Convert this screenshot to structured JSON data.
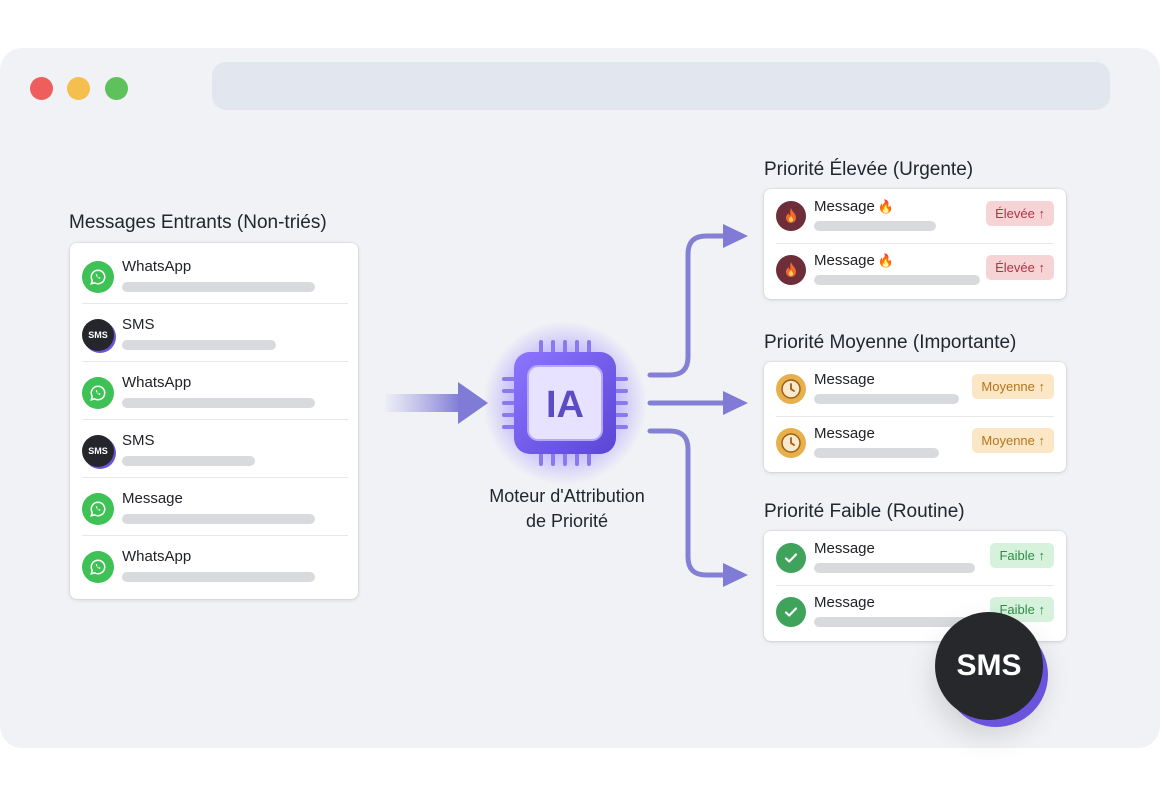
{
  "window": {
    "controls": [
      "close",
      "minimize",
      "maximize"
    ],
    "colors": {
      "close": "#ee5e5d",
      "minimize": "#f4bf4e",
      "maximize": "#5dc25b"
    }
  },
  "inbox": {
    "title": "Messages Entrants (Non-triés)",
    "items": [
      {
        "label": "WhatsApp",
        "icon": "whatsapp-icon"
      },
      {
        "label": "SMS",
        "icon": "sms-icon",
        "icon_text": "SMS"
      },
      {
        "label": "WhatsApp",
        "icon": "whatsapp-icon"
      },
      {
        "label": "SMS",
        "icon": "sms-icon",
        "icon_text": "SMS"
      },
      {
        "label": "Message",
        "icon": "whatsapp-icon"
      },
      {
        "label": "WhatsApp",
        "icon": "whatsapp-icon"
      }
    ]
  },
  "engine": {
    "chip_label": "IA",
    "caption_line1": "Moteur d'Attribution",
    "caption_line2": "de Priorité",
    "accent_color": "#6c5ce7"
  },
  "priorities": {
    "high": {
      "title": "Priorité Élevée (Urgente)",
      "color": "#b03441",
      "items": [
        {
          "label": "Message",
          "badge": "Élevée ↑",
          "icon": "fire-icon"
        },
        {
          "label": "Message",
          "badge": "Élevée ↑",
          "icon": "fire-icon"
        }
      ]
    },
    "medium": {
      "title": "Priorité Moyenne (Importante)",
      "color": "#b5741b",
      "items": [
        {
          "label": "Message",
          "badge": "Moyenne ↑",
          "icon": "clock-icon"
        },
        {
          "label": "Message",
          "badge": "Moyenne ↑",
          "icon": "clock-icon"
        }
      ]
    },
    "low": {
      "title": "Priorité Faible (Routine)",
      "color": "#2f8f49",
      "items": [
        {
          "label": "Message",
          "badge": "Faible ↑",
          "icon": "check-icon"
        },
        {
          "label": "Message",
          "badge": "Faible ↑",
          "icon": "check-icon"
        }
      ]
    }
  },
  "floating_badge": {
    "text": "SMS"
  }
}
